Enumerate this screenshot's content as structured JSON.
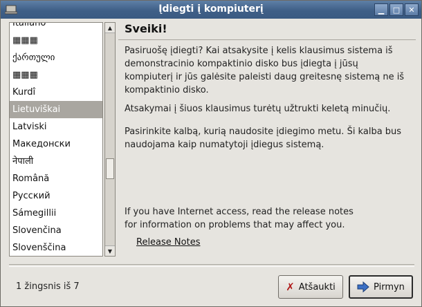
{
  "window": {
    "title": "Įdiegti į kompiuterį"
  },
  "languages": [
    {
      "label": "Italiano",
      "selected": false
    },
    {
      "label": "▦▦▦",
      "selected": false
    },
    {
      "label": "ქართული",
      "selected": false
    },
    {
      "label": "▦▦▦",
      "selected": false
    },
    {
      "label": "Kurdî",
      "selected": false
    },
    {
      "label": "Lietuviškai",
      "selected": true
    },
    {
      "label": "Latviski",
      "selected": false
    },
    {
      "label": "Македонски",
      "selected": false
    },
    {
      "label": "नेपाली",
      "selected": false
    },
    {
      "label": "Română",
      "selected": false
    },
    {
      "label": "Русский",
      "selected": false
    },
    {
      "label": "Sámegillii",
      "selected": false
    },
    {
      "label": "Slovenčina",
      "selected": false
    },
    {
      "label": "Slovenščina",
      "selected": false
    }
  ],
  "main": {
    "heading": "Sveiki!",
    "p1": "Pasiruošę įdiegti? Kai atsakysite į kelis klausimus sistema iš demonstracinio kompaktinio disko bus įdiegta į jūsų kompiuterį ir jūs galėsite paleisti daug greitesnę sistemą ne iš kompaktinio disko.",
    "p2": "Atsakymai į šiuos klausimus turėtų užtrukti keletą minučių.",
    "p3": "Pasirinkite kalbą, kurią naudosite įdiegimo metu. Ši kalba bus naudojama kaip numatytoji įdiegus sistemą.",
    "internet_note": "If you have Internet access, read the release notes for information on problems that may affect you.",
    "release_notes_link": "Release Notes"
  },
  "footer": {
    "step": "1 žingsnis iš 7",
    "cancel_label": "Atšaukti",
    "next_label": "Pirmyn"
  }
}
